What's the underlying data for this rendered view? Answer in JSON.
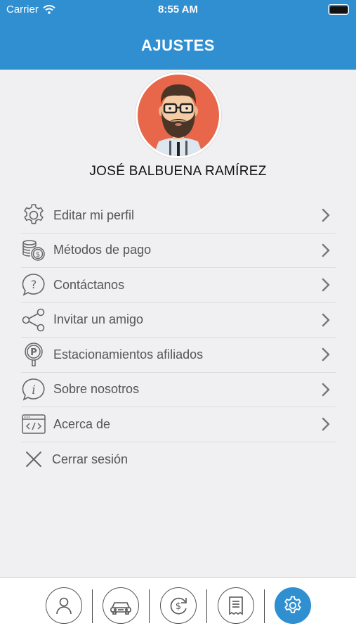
{
  "status_bar": {
    "carrier": "Carrier",
    "time": "8:55 AM"
  },
  "header": {
    "title": "AJUSTES"
  },
  "profile": {
    "name": "JOSÉ BALBUENA RAMÍREZ"
  },
  "menu": [
    {
      "label": "Editar mi perfil",
      "icon": "gear-icon"
    },
    {
      "label": "Métodos de pago",
      "icon": "coins-icon"
    },
    {
      "label": "Contáctanos",
      "icon": "question-bubble-icon"
    },
    {
      "label": "Invitar un amigo",
      "icon": "share-icon"
    },
    {
      "label": "Estacionamientos afiliados",
      "icon": "parking-pin-icon"
    },
    {
      "label": "Sobre nosotros",
      "icon": "info-bubble-icon"
    },
    {
      "label": "Acerca de",
      "icon": "code-window-icon"
    }
  ],
  "logout": {
    "label": "Cerrar sesión",
    "icon": "close-icon"
  },
  "tabbar": {
    "tabs": [
      {
        "icon": "user-icon"
      },
      {
        "icon": "car-icon"
      },
      {
        "icon": "dollar-refresh-icon"
      },
      {
        "icon": "receipt-icon"
      },
      {
        "icon": "gear-icon",
        "active": true
      }
    ]
  },
  "colors": {
    "accent": "#2f8fd1",
    "background": "#f0f0f2",
    "avatar_bg": "#e8674a"
  }
}
